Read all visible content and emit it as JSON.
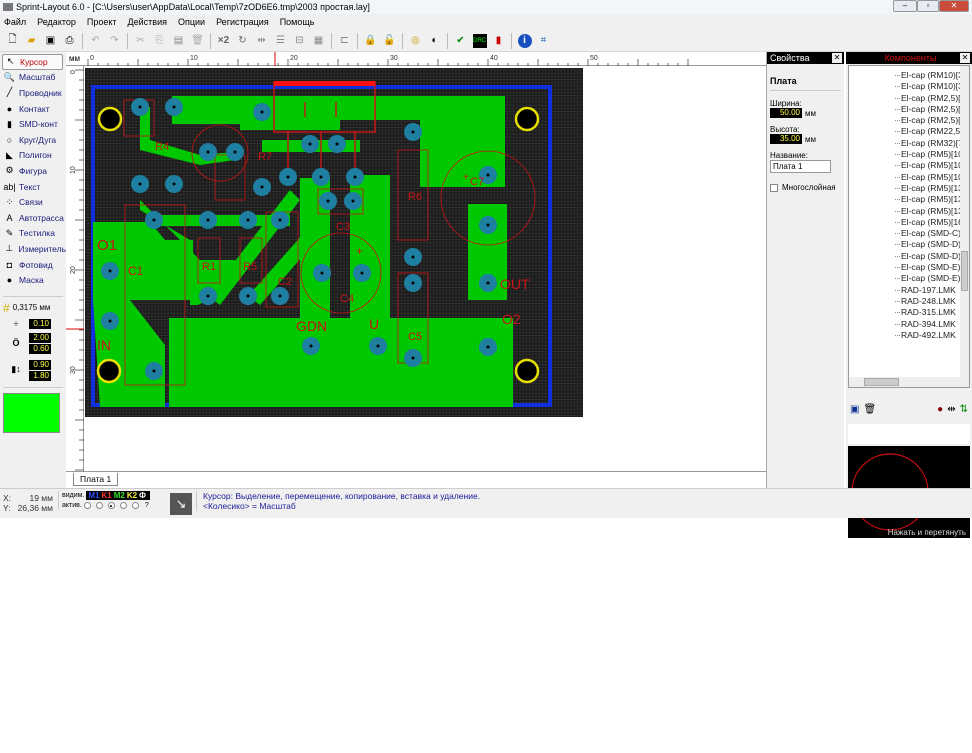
{
  "window": {
    "title": "Sprint-Layout 6.0 - [C:\\Users\\user\\AppData\\Local\\Temp\\7zOD6E6.tmp\\2003 простая.lay]",
    "controls": [
      "–",
      "▫",
      "✕"
    ]
  },
  "menu": [
    "Файл",
    "Редактор",
    "Проект",
    "Действия",
    "Опции",
    "Регистрация",
    "Помощь"
  ],
  "toolbar": {
    "icons": [
      "new-icon",
      "open-icon",
      "save-icon",
      "print-icon",
      "undo-icon",
      "redo-icon",
      "cut-icon",
      "copy-icon",
      "paste-icon",
      "delete-icon",
      "x2-icon",
      "rotate-icon",
      "mirror-icon",
      "align-icon",
      "group-icon",
      "grid-icon",
      "layer-icon",
      "lock-icon",
      "unlock-icon",
      "zoom-icon",
      "contrast-icon",
      "drc-check-icon",
      "drc-icon",
      "battery-icon",
      "info-icon",
      "autoroute-icon"
    ],
    "x2_label": "×2"
  },
  "tools": [
    {
      "label": "Курсор",
      "icon": "cursor-icon",
      "glyph": "↖",
      "active": true
    },
    {
      "label": "Масштаб",
      "icon": "magnifier-icon",
      "glyph": "🔍"
    },
    {
      "label": "Проводник",
      "icon": "track-icon",
      "glyph": "╱"
    },
    {
      "label": "Контакт",
      "icon": "pad-icon",
      "glyph": "●"
    },
    {
      "label": "SMD-конт",
      "icon": "smd-pad-icon",
      "glyph": "▮"
    },
    {
      "label": "Круг/Дуга",
      "icon": "circle-icon",
      "glyph": "○"
    },
    {
      "label": "Полигон",
      "icon": "polygon-icon",
      "glyph": "◣"
    },
    {
      "label": "Фигура",
      "icon": "shape-icon",
      "glyph": "⚙"
    },
    {
      "label": "Текст",
      "icon": "text-icon",
      "glyph": "ab|"
    },
    {
      "label": "Связи",
      "icon": "connections-icon",
      "glyph": "⁘"
    },
    {
      "label": "Автотрасса",
      "icon": "autoroute-icon",
      "glyph": "A"
    },
    {
      "label": "Тестилка",
      "icon": "tester-icon",
      "glyph": "✎"
    },
    {
      "label": "Измеритель",
      "icon": "measure-icon",
      "glyph": "⊥"
    },
    {
      "label": "Фотовид",
      "icon": "camera-icon",
      "glyph": "◘"
    },
    {
      "label": "Маска",
      "icon": "mask-icon",
      "glyph": "●"
    }
  ],
  "settings": {
    "grid": "0,3175 мм",
    "track_width": "0.10",
    "pad_outer": "2.00",
    "pad_inner": "0.60",
    "smd_width": "0.90",
    "smd_height": "1.80",
    "current_color": "#00ff00"
  },
  "ruler": {
    "unit": "мм",
    "top_ticks": [
      "0",
      "10",
      "20",
      "30",
      "40",
      "50"
    ],
    "left_ticks": [
      "0",
      "10",
      "20",
      "30"
    ]
  },
  "pcb": {
    "colors": {
      "background": "#1a1a1a",
      "copper": "#00c800",
      "pad": "#1e7fa0",
      "outline": "#1030e0",
      "silk": "#c81414",
      "hole_ring": "#e8e000"
    },
    "labels": [
      "O1",
      "C1",
      "IN",
      "GDN",
      "U",
      "OUT",
      "O2",
      "C4",
      "C2",
      "R1",
      "R5",
      "R4",
      "R7",
      "R6",
      "C7",
      "C5",
      "C3",
      "D1",
      "+",
      "+"
    ]
  },
  "board_tab": "Плата 1",
  "properties": {
    "title": "Свойства",
    "section": "Плата",
    "width_label": "Ширина:",
    "width": "50.00",
    "height_label": "Высота:",
    "height": "35.00",
    "unit": "мм",
    "name_label": "Название:",
    "name": "Плата 1",
    "multilayer_label": "Многослойная",
    "multilayer": false
  },
  "components": {
    "title": "Компоненты",
    "items": [
      "El-cap (RM10)[35",
      "El-cap (RM10)[35",
      "El-cap (RM2,5)[6,",
      "El-cap (RM2,5)[8",
      "El-cap (RM2,5)[8",
      "El-cap (RM22,5)[",
      "El-cap (RM32)[76",
      "El-cap (RM5)[10)",
      "El-cap (RM5)[10)",
      "El-cap (RM5)[10)",
      "El-cap (RM5)[13)",
      "El-cap (RM5)[13)",
      "El-cap (RM5)[13)",
      "El-cap (RM5)[16)",
      "El-cap (SMD-C) 2",
      "El-cap (SMD-D) 1",
      "El-cap (SMD-D) 1",
      "El-cap (SMD-E) 2",
      "El-cap (SMD-E) 3",
      "RAD-197.LMK",
      "RAD-248.LMK",
      "RAD-315.LMK",
      "RAD-394.LMK",
      "RAD-492.LMK"
    ],
    "preview_hint": "Нажать и перетянуть"
  },
  "status": {
    "x_label": "X:",
    "x": "19 мм",
    "y_label": "Y:",
    "y": "26,36 мм",
    "visible_label": "видим.",
    "active_label": "актив.",
    "layers": [
      {
        "name": "M1",
        "color": "#3050ff"
      },
      {
        "name": "K1",
        "color": "#ff3030"
      },
      {
        "name": "M2",
        "color": "#30e030"
      },
      {
        "name": "K2",
        "color": "#f0f040"
      },
      {
        "name": "Ф",
        "color": "#ffffff"
      }
    ],
    "active_layer": 2,
    "help": "?",
    "message1": "Курсор: Выделение, перемещение, копирование, вставка и удаление.",
    "message2": "<Колесико> = Масштаб"
  }
}
